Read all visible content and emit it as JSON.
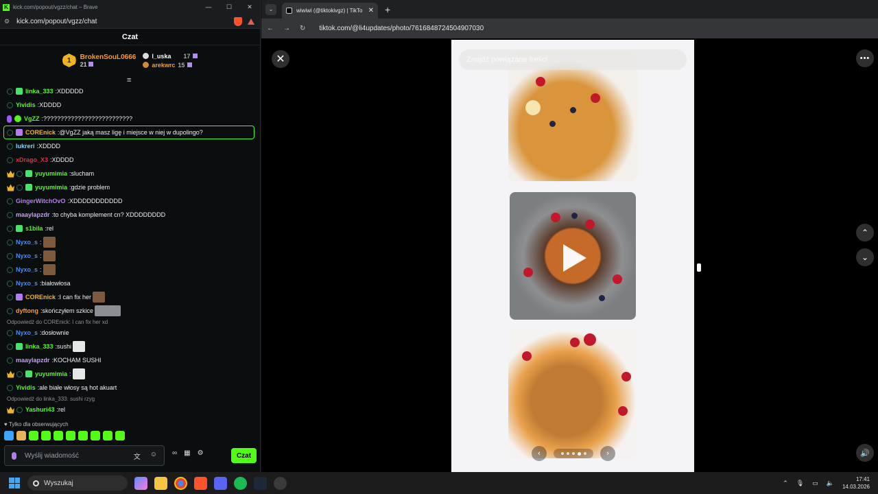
{
  "kick": {
    "title_bar": "kick.com/popout/vgzz/chat – Brave",
    "url": "kick.com/popout/vgzz/chat",
    "header": "Czat",
    "top_gifters": {
      "first": {
        "rank": "1",
        "name": "BrokenSouL0666",
        "count": "21"
      },
      "second": {
        "name": "l_uska",
        "count": "17"
      },
      "third": {
        "name": "arekwrc",
        "count": "15"
      }
    },
    "messages": [
      {
        "user": "linka_333",
        "color": "#53fc18",
        "text": "XDDDDD",
        "badges": [
          "sub",
          "gift"
        ]
      },
      {
        "user": "Yividis",
        "color": "#53fc18",
        "text": "XDDDD",
        "badges": [
          "sub"
        ]
      },
      {
        "user": "VgZZ",
        "color": "#53fc18",
        "text": "??????????????????????????",
        "badges": [
          "mic",
          "vip"
        ]
      },
      {
        "user": "COREnick",
        "color": "#f0b323",
        "text": "@VgZZ jaką masz ligę i miejsce w niej w dupolingo?",
        "badges": [
          "sub",
          "giftp"
        ]
      },
      {
        "user": "lukreri",
        "color": "#7fd3ff",
        "text": "XDDDD",
        "badges": [
          "sub"
        ]
      },
      {
        "user": "xDrago_X3",
        "color": "#e02e45",
        "text": "XDDDD",
        "badges": [
          "sub"
        ]
      },
      {
        "user": "yuyumimia",
        "color": "#53fc18",
        "text": "slucham",
        "badges": [
          "crown",
          "sub",
          "gift"
        ]
      },
      {
        "user": "yuyumimia",
        "color": "#53fc18",
        "text": "gdzie problem",
        "badges": [
          "crown",
          "sub",
          "gift"
        ]
      },
      {
        "user": "GingerWitchOvO",
        "color": "#b57bf0",
        "text": "XDDDDDDDDDDD",
        "badges": [
          "sub"
        ]
      },
      {
        "user": "maaylapzdr",
        "color": "#c59cf7",
        "text": "to chyba komplement cn? XDDDDDDDD",
        "badges": [
          "sub"
        ]
      },
      {
        "user": "s1bila",
        "color": "#53fc18",
        "text": "rel",
        "badges": [
          "sub",
          "gift"
        ]
      },
      {
        "user": "Nyxo_s",
        "color": "#4a8bff",
        "text": "",
        "badges": [
          "sub"
        ],
        "emote": "small"
      },
      {
        "user": "Nyxo_s",
        "color": "#4a8bff",
        "text": "",
        "badges": [
          "sub"
        ],
        "emote": "small"
      },
      {
        "user": "Nyxo_s",
        "color": "#4a8bff",
        "text": "",
        "badges": [
          "sub"
        ],
        "emote": "small"
      },
      {
        "user": "Nyxo_s",
        "color": "#4a8bff",
        "text": "białowłosa",
        "badges": [
          "sub"
        ]
      },
      {
        "user": "COREnick",
        "color": "#f0b323",
        "text": "I can fix her",
        "badges": [
          "sub",
          "giftp"
        ],
        "emote": "small"
      },
      {
        "user": "dyftong",
        "color": "#ff9a2e",
        "text": "skończyłem szkice",
        "badges": [
          "sub"
        ],
        "emote": "wide"
      },
      {
        "reply": "Odpowiedź do COREnick: I can fix her xd"
      },
      {
        "user": "Nyxo_s",
        "color": "#4a8bff",
        "text": "dosłownie",
        "badges": [
          "sub"
        ]
      },
      {
        "user": "linka_333",
        "color": "#53fc18",
        "text": "sushi",
        "badges": [
          "sub",
          "gift"
        ],
        "emote": "white"
      },
      {
        "user": "maaylapzdr",
        "color": "#c59cf7",
        "text": "KOCHAM SUSHI",
        "badges": [
          "sub"
        ]
      },
      {
        "user": "yuyumimia",
        "color": "#53fc18",
        "text": "",
        "badges": [
          "crown",
          "sub",
          "gift"
        ],
        "emote": "white"
      },
      {
        "user": "Yividis",
        "color": "#53fc18",
        "text": "ale białe włosy są hot akuart",
        "badges": [
          "sub"
        ]
      },
      {
        "reply": "Odpowiedź do linka_333: sushi rzyg"
      },
      {
        "user": "Yashuri43",
        "color": "#53fc18",
        "text": "rel",
        "badges": [
          "crown",
          "sub"
        ]
      }
    ],
    "followers_only": "Tylko dla obserwujących",
    "input_placeholder": "Wyślij wiadomość",
    "send_label": "Czat"
  },
  "tiktok": {
    "tab_title": "wiwiwi (@tiktokivgz) | TikTo",
    "url": "tiktok.com/@li4updates/photo/7616848724504907030",
    "search_placeholder": "Znajdź powiązane treści",
    "slide_current": 4,
    "slide_total": 5
  },
  "taskbar": {
    "search_label": "Wyszukaj",
    "time": "17:41",
    "date": "14.03.2026"
  },
  "colors": {
    "kick_green": "#53fc18",
    "tiktok_bg": "#000000",
    "panel_bg": "#f4f3f6"
  }
}
